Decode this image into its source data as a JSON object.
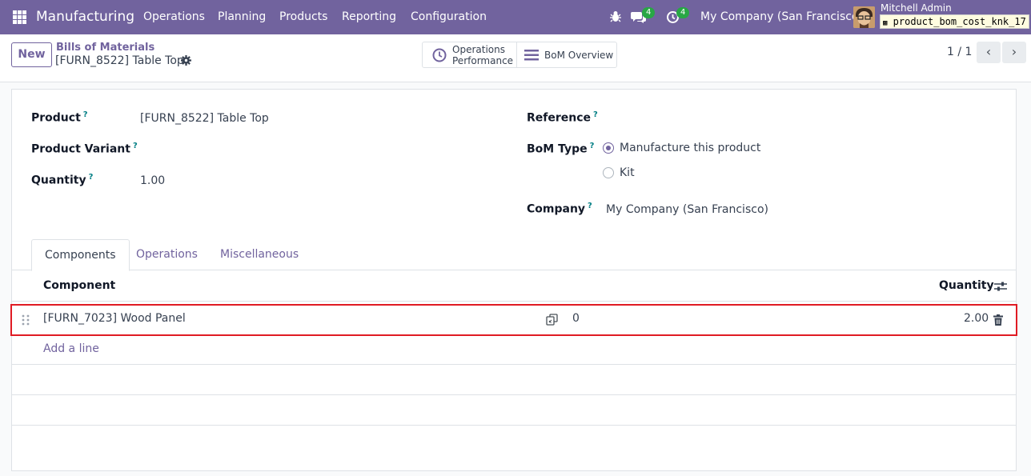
{
  "navbar": {
    "app_name": "Manufacturing",
    "menu": [
      "Operations",
      "Planning",
      "Products",
      "Reporting",
      "Configuration"
    ],
    "chat_count": "4",
    "activity_count": "4",
    "company": "My Company (San Francisco)",
    "user_name": "Mitchell Admin",
    "database": "product_bom_cost_knk_17"
  },
  "control": {
    "new_label": "New",
    "breadcrumb_parent": "Bills of Materials",
    "breadcrumb_current": "[FURN_8522] Table Top",
    "smart_buttons": [
      {
        "line1": "Operations",
        "line2": "Performance",
        "icon": "clock-icon"
      },
      {
        "line1": "BoM Overview",
        "line2": "",
        "icon": "bars-icon"
      }
    ],
    "pager": "1 / 1"
  },
  "form": {
    "product_label": "Product",
    "product_value": "[FURN_8522] Table Top",
    "variant_label": "Product Variant",
    "variant_value": "",
    "quantity_label": "Quantity",
    "quantity_value": "1.00",
    "reference_label": "Reference",
    "reference_value": "",
    "bom_type_label": "BoM Type",
    "bom_type_options": [
      "Manufacture this product",
      "Kit"
    ],
    "bom_type_selected": "Manufacture this product",
    "company_label": "Company",
    "company_value": "My Company (San Francisco)",
    "help_mark": "?"
  },
  "tabs": [
    "Components",
    "Operations",
    "Miscellaneous"
  ],
  "table": {
    "headers": {
      "component": "Component",
      "quantity": "Quantity"
    },
    "rows": [
      {
        "component": "[FURN_7023] Wood Panel",
        "extra": "0",
        "quantity": "2.00"
      }
    ],
    "add_line": "Add a line"
  },
  "colors": {
    "brand": "#71639e",
    "highlight": "#e01b24",
    "badge": "#28a745",
    "help": "#017e84"
  }
}
